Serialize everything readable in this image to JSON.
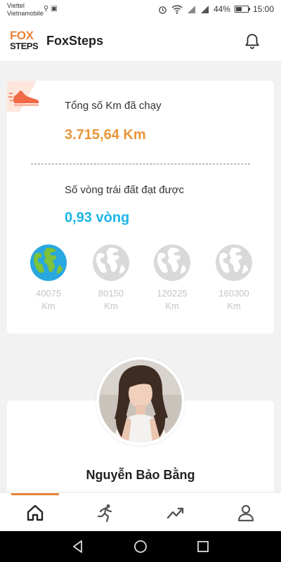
{
  "status_bar": {
    "carrier_line1": "Viettel",
    "carrier_line2": "Vietnamobile",
    "battery_percent": "44%",
    "time": "15:00"
  },
  "app_bar": {
    "logo_top": "FOX",
    "logo_bottom": "STEPS",
    "title": "FoxSteps"
  },
  "stats": {
    "total_km_label": "Tổng số Km đã chạy",
    "total_km_value": "3.715,64 Km",
    "rounds_label": "Số vòng trái đất đạt được",
    "rounds_value": "0,93 vòng",
    "milestones": [
      {
        "km": "40075",
        "unit": "Km",
        "achieved": true
      },
      {
        "km": "80150",
        "unit": "Km",
        "achieved": false
      },
      {
        "km": "120225",
        "unit": "Km",
        "achieved": false
      },
      {
        "km": "160300",
        "unit": "Km",
        "achieved": false
      }
    ]
  },
  "profile": {
    "name": "Nguyễn Bảo Bằng"
  },
  "bottom_nav": {
    "items": [
      "home-icon",
      "running-icon",
      "trending-up-icon",
      "profile-icon"
    ],
    "active_index": 0
  },
  "colors": {
    "brand_orange": "#e8833a",
    "km_value": "#e8953a",
    "rounds_value": "#1cb5e8",
    "globe_inactive": "#d9d9d9"
  }
}
